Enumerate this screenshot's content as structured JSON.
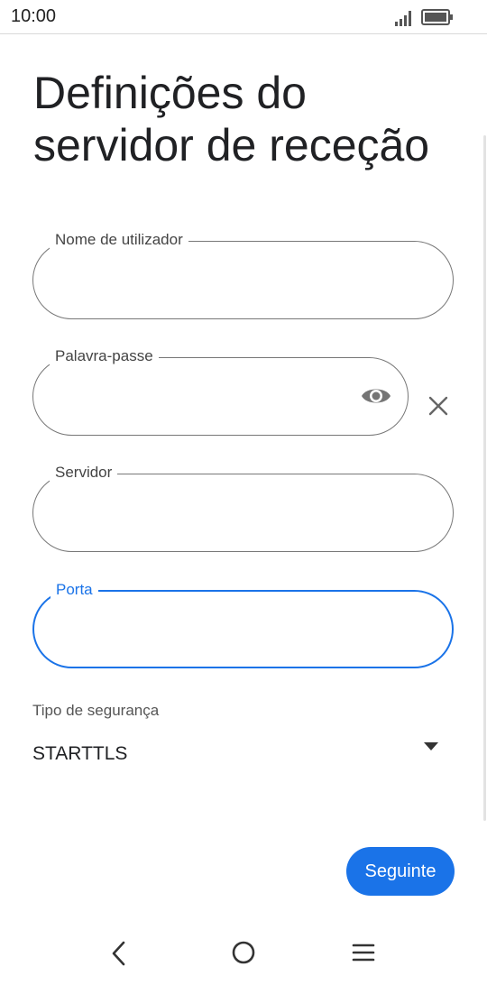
{
  "status_bar": {
    "time": "10:00",
    "icons": [
      "signal-icon",
      "battery-icon"
    ]
  },
  "page": {
    "title": "Definições do servidor de receção"
  },
  "fields": {
    "username": {
      "label": "Nome de utilizador",
      "value": ""
    },
    "password": {
      "label": "Palavra-passe",
      "value": "",
      "icons": [
        "eye-icon",
        "clear-icon"
      ]
    },
    "server": {
      "label": "Servidor",
      "value": ""
    },
    "port": {
      "label": "Porta",
      "value": "",
      "focused": true
    }
  },
  "security": {
    "label": "Tipo de segurança",
    "selected": "STARTTLS"
  },
  "actions": {
    "next_label": "Seguinte"
  },
  "nav_bar": {
    "icons": [
      "back-icon",
      "home-icon",
      "menu-icon"
    ]
  },
  "colors": {
    "accent": "#1a73e8",
    "outline": "#777777",
    "text": "#202124"
  }
}
